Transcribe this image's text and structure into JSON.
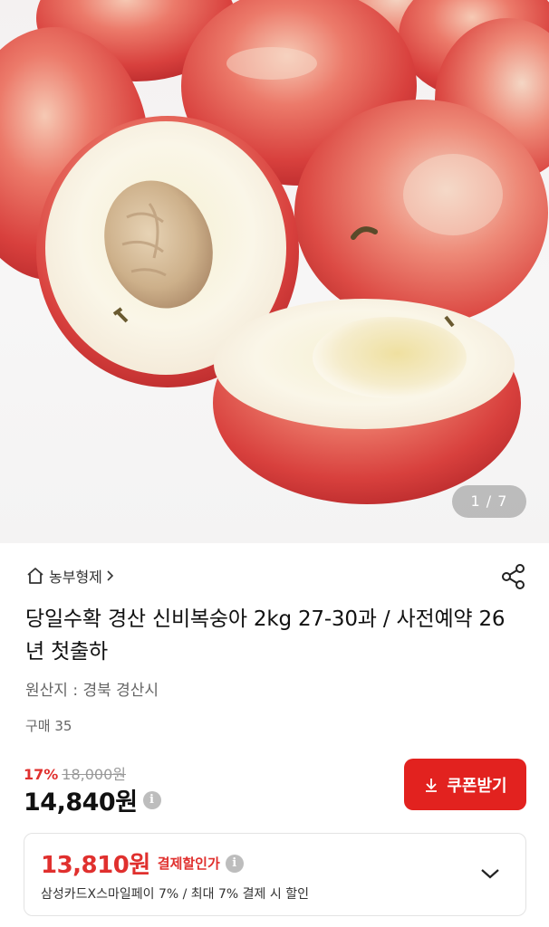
{
  "gallery": {
    "counter": "1 / 7",
    "image_alt": "nectarine-peaches-photo"
  },
  "seller": {
    "name": "농부형제",
    "icon": "home-icon"
  },
  "product": {
    "title": "당일수확 경산 신비복숭아 2kg 27-30과 / 사전예약 26년 첫출하",
    "origin": "원산지 : 경북 경산시",
    "purchases": "구매 35"
  },
  "pricing": {
    "discount_rate": "17%",
    "original_price": "18,000원",
    "sale_price": "14,840원",
    "coupon_button": "쿠폰받기"
  },
  "payment_discount": {
    "price": "13,810원",
    "label": "결제할인가",
    "description": "삼성카드X스마일페이 7% / 최대 7% 결제 시 할인"
  },
  "colors": {
    "accent_red": "#e2221f",
    "discount_red": "#e0302e"
  }
}
